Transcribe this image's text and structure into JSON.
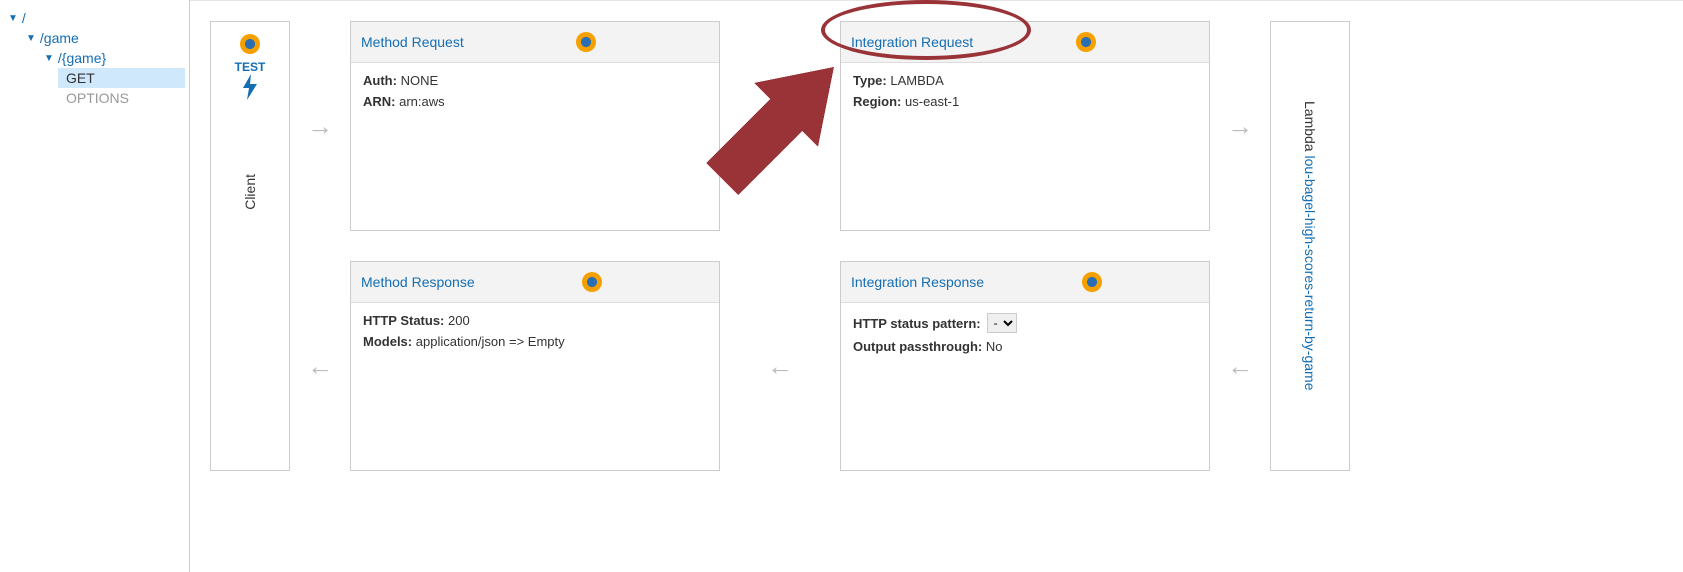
{
  "sidebar": {
    "root": "/",
    "game": "/game",
    "gamePath": "/{game}",
    "methods": {
      "get": "GET",
      "options": "OPTIONS"
    }
  },
  "client": {
    "test": "TEST",
    "bolt": "⚡",
    "label": "Client"
  },
  "lambda": {
    "prefix": "Lambda ",
    "fn": "lou-bagel-high-scores-return-by-game"
  },
  "boxes": {
    "methodRequest": {
      "title": "Method Request",
      "authLabel": "Auth:",
      "authValue": "NONE",
      "arnLabel": "ARN:",
      "arnValue": "arn:aws"
    },
    "integrationRequest": {
      "title": "Integration Request",
      "typeLabel": "Type:",
      "typeValue": "LAMBDA",
      "regionLabel": "Region:",
      "regionValue": "us-east-1"
    },
    "methodResponse": {
      "title": "Method Response",
      "httpLabel": "HTTP Status:",
      "httpValue": "200",
      "modelsLabel": "Models:",
      "modelsValue": "application/json => Empty"
    },
    "integrationResponse": {
      "title": "Integration Response",
      "patternLabel": "HTTP status pattern:",
      "patternSelectOption": "-",
      "passthroughLabel": "Output passthrough:",
      "passthroughValue": "No"
    }
  },
  "arrows": {
    "right": "→",
    "left": "←"
  }
}
